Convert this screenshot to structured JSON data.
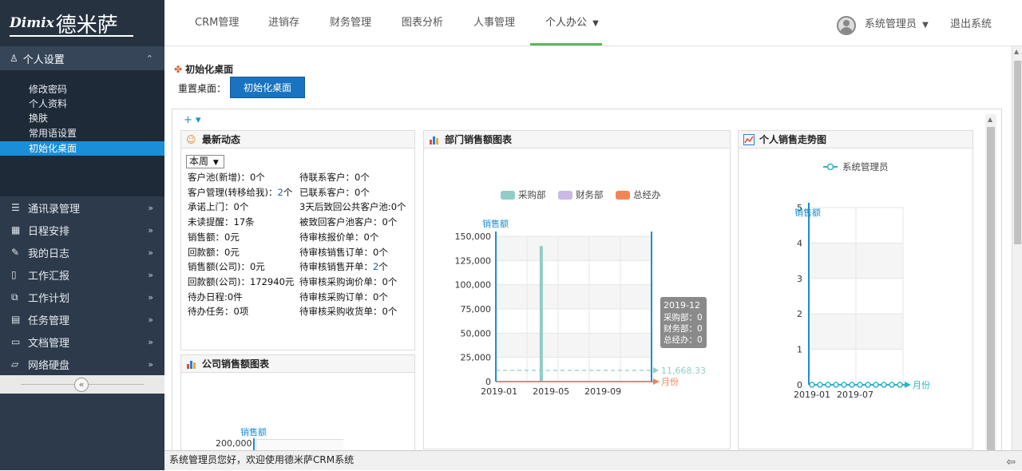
{
  "logo": {
    "latin": "Dimix",
    "cjk": "德米萨"
  },
  "sidebar": {
    "personal_header": "个人设置",
    "personal_items": [
      "修改密码",
      "个人资料",
      "换肤",
      "常用语设置",
      "初始化桌面"
    ],
    "groups": [
      {
        "label": "通讯录管理",
        "icon": "list-icon"
      },
      {
        "label": "日程安排",
        "icon": "calendar-icon"
      },
      {
        "label": "我的日志",
        "icon": "pencil-icon"
      },
      {
        "label": "工作汇报",
        "icon": "document-icon"
      },
      {
        "label": "工作计划",
        "icon": "copy-icon"
      },
      {
        "label": "任务管理",
        "icon": "task-icon"
      },
      {
        "label": "文档管理",
        "icon": "folder-icon"
      },
      {
        "label": "网络硬盘",
        "icon": "folder-open-icon"
      }
    ],
    "collapse_glyph": "«"
  },
  "topbar": {
    "menus": [
      "CRM管理",
      "进销存",
      "财务管理",
      "图表分析",
      "人事管理",
      "个人办公"
    ],
    "active_menu": "个人办公",
    "user_name": "系统管理员",
    "logout": "退出系统"
  },
  "content": {
    "init_title": "初始化桌面",
    "reset_label": "重置桌面：",
    "init_button": "初始化桌面",
    "tools": "+ ▾"
  },
  "news_panel": {
    "title": "最新动态",
    "week_select": "本周",
    "left": [
      {
        "label": "客户池(新增)：",
        "value": "0个",
        "highlight": false
      },
      {
        "label": "客户管理(转移给我)：",
        "value": "2个",
        "highlight": true
      },
      {
        "label": "承诺上门：",
        "value": "0个",
        "highlight": false
      },
      {
        "label": "未读提醒：",
        "value": "17条",
        "highlight": false
      },
      {
        "label": "销售额：",
        "value": "0元",
        "highlight": false
      },
      {
        "label": "回款额：",
        "value": "0元",
        "highlight": false
      },
      {
        "label": "销售额(公司)：",
        "value": "0元",
        "highlight": false
      },
      {
        "label": "回款额(公司)：",
        "value": "172940元",
        "highlight": false
      },
      {
        "label": "待办日程:",
        "value": "0件",
        "highlight": false
      },
      {
        "label": "待办任务：",
        "value": "0项",
        "highlight": false
      }
    ],
    "right": [
      {
        "label": "待联系客户：",
        "value": "0个",
        "highlight": false
      },
      {
        "label": "已联系客户：",
        "value": "0个",
        "highlight": false
      },
      {
        "label": "3天后致回公共客户池:",
        "value": "0个",
        "highlight": false
      },
      {
        "label": "被致回客户池客户：",
        "value": "0个",
        "highlight": false
      },
      {
        "label": "待审核报价单：",
        "value": "0个",
        "highlight": false
      },
      {
        "label": "待审核销售订单：",
        "value": "0个",
        "highlight": false
      },
      {
        "label": "待审核销售开单：",
        "value": "2个",
        "highlight": true
      },
      {
        "label": "待审核采购询价单：",
        "value": "0个",
        "highlight": false
      },
      {
        "label": "待审核采购订单：",
        "value": "0个",
        "highlight": false
      },
      {
        "label": "待审核采购收货单：",
        "value": "0个",
        "highlight": false
      }
    ]
  },
  "company_panel": {
    "title": "公司销售额图表",
    "ylabel": "销售额",
    "visible_tick": "200,000"
  },
  "footer": {
    "text": "系统管理员您好，欢迎使用德米萨CRM系统"
  },
  "chart_data": [
    {
      "type": "bar",
      "title": "部门销售额图表",
      "ylabel": "销售额",
      "xlabel": "月份",
      "ylim": [
        0,
        150000
      ],
      "yticks": [
        "0",
        "25,000",
        "50,000",
        "75,000",
        "100,000",
        "125,000",
        "150,000"
      ],
      "xticks": [
        "2019-01",
        "2019-05",
        "2019-09"
      ],
      "categories": [
        "2019-01",
        "2019-02",
        "2019-03",
        "2019-04",
        "2019-05",
        "2019-06",
        "2019-07",
        "2019-08",
        "2019-09",
        "2019-10",
        "2019-11",
        "2019-12"
      ],
      "series": [
        {
          "name": "采购部",
          "color": "#8fcdc6",
          "values": [
            0,
            0,
            0,
            140000,
            0,
            0,
            0,
            0,
            0,
            0,
            0,
            0
          ]
        },
        {
          "name": "财务部",
          "color": "#c9b9e6",
          "values": [
            0,
            0,
            0,
            0,
            0,
            0,
            0,
            0,
            0,
            0,
            0,
            0
          ]
        },
        {
          "name": "总经办",
          "color": "#f58455",
          "values": [
            0,
            0,
            0,
            0,
            0,
            0,
            0,
            0,
            0,
            0,
            0,
            0
          ]
        }
      ],
      "average_line": {
        "label": "11,668.33",
        "value": 11668.33
      },
      "tooltip": {
        "title": "2019-12",
        "lines": [
          "采购部：0",
          "财务部：0",
          "总经办：0"
        ]
      },
      "legend": "top"
    },
    {
      "type": "line",
      "title": "个人销售走势图",
      "ylabel": "销售额",
      "xlabel": "月份",
      "ylim": [
        0,
        5
      ],
      "yticks": [
        "0",
        "1",
        "2",
        "3",
        "4",
        "5"
      ],
      "xticks": [
        "2019-01",
        "2019-07"
      ],
      "categories": [
        "2019-01",
        "2019-02",
        "2019-03",
        "2019-04",
        "2019-05",
        "2019-06",
        "2019-07",
        "2019-08",
        "2019-09",
        "2019-10",
        "2019-11",
        "2019-12"
      ],
      "series": [
        {
          "name": "系统管理员",
          "color": "#2bb5c0",
          "values": [
            0,
            0,
            0,
            0,
            0,
            0,
            0,
            0,
            0,
            0,
            0,
            0
          ]
        }
      ],
      "legend": "top"
    }
  ]
}
